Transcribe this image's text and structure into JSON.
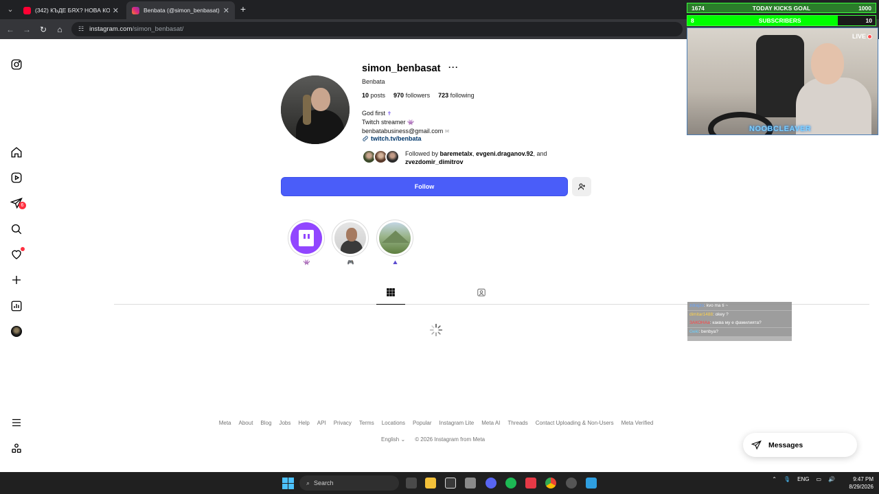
{
  "browser": {
    "tabs": [
      {
        "title": "(342) КЪДЕ БЯХ? НОВА КО",
        "active": false
      },
      {
        "title": "Benbata (@simon_benbasat) • I",
        "active": true
      }
    ],
    "url_host": "instagram.com",
    "url_path": "/simon_benbasat/"
  },
  "sidebar": {
    "notifications_badge": "6"
  },
  "profile": {
    "username": "simon_benbasat",
    "more": "···",
    "full_name": "Benbata",
    "posts_count": "10",
    "posts_label": "posts",
    "followers_count": "970",
    "followers_label": "followers",
    "following_count": "723",
    "following_label": "following",
    "bio_line1": "God first",
    "bio_line2": "Twitch streamer",
    "bio_line3": "benbatabusiness@gmail.com",
    "link": "twitch.tv/benbata",
    "followed_by_prefix": "Followed by",
    "followed_user1": "baremetalx",
    "followed_user2": "evgeni.draganov.92",
    "followed_sep": ", and",
    "followed_user3": "zvezdomir_dimitrov",
    "follow_button": "Follow"
  },
  "highlights": [
    {
      "label": "👾",
      "kind": "twitch"
    },
    {
      "label": "🎮",
      "kind": "man"
    },
    {
      "label": "⛰",
      "kind": "nature"
    }
  ],
  "footer": {
    "links": [
      "Meta",
      "About",
      "Blog",
      "Jobs",
      "Help",
      "API",
      "Privacy",
      "Terms",
      "Locations",
      "Popular",
      "Instagram Lite",
      "Meta AI",
      "Threads",
      "Contact Uploading & Non-Users",
      "Meta Verified"
    ],
    "language": "English",
    "copyright": "© 2026 Instagram from Meta"
  },
  "messages_button": "Messages",
  "stream": {
    "goal_current": "1674",
    "goal_label": "TODAY KICKS GOAL",
    "goal_target": "1000",
    "subs_current": "8",
    "subs_label": "SUBSCRIBERS",
    "subs_target": "10",
    "subs_progress": 0.8,
    "live_label": "LIVE",
    "cam_name": "NOOBCLEAVER",
    "chat": [
      {
        "user": "zdrajzo",
        "msg": "kvo ma ti ~"
      },
      {
        "user": "dimitar1488",
        "msg": "okey ?"
      },
      {
        "user": "ЗАКОНАа",
        "msg": "каква му е фамилията?"
      },
      {
        "user": "Geki",
        "msg": "benbya?"
      }
    ]
  },
  "taskbar": {
    "search_placeholder": "Search",
    "lang": "ENG",
    "time": "9:47 PM",
    "date": "8/29/2026"
  },
  "colors": {
    "follow_blue": "#4a5df9",
    "twitch_purple": "#9146ff",
    "badge_red": "#ff3040"
  }
}
